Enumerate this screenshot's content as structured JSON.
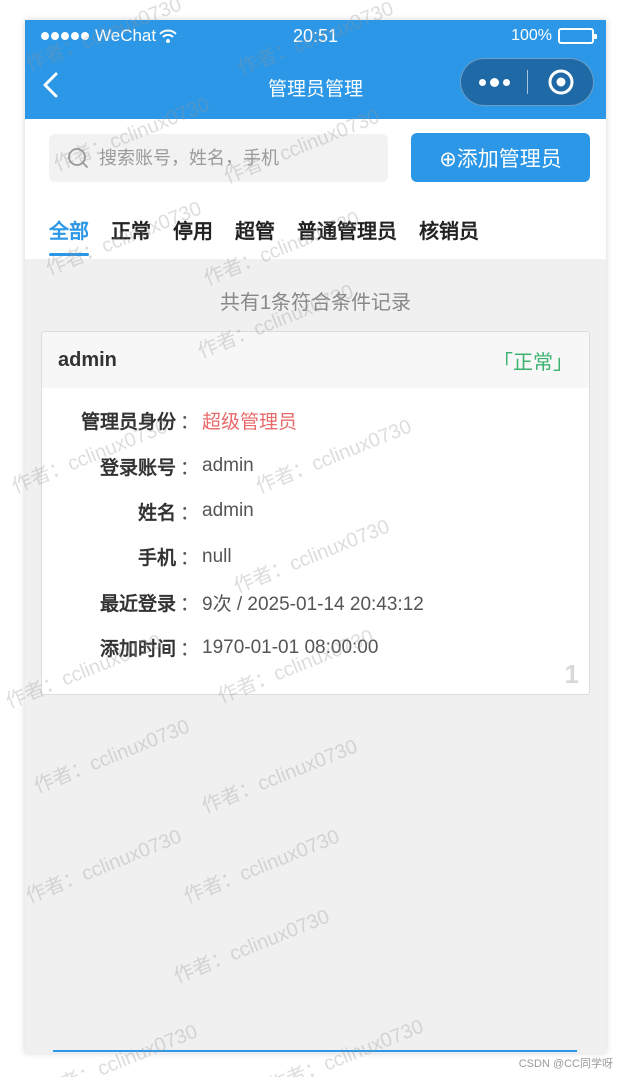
{
  "status_bar": {
    "carrier": "WeChat",
    "time": "20:51",
    "battery": "100%"
  },
  "nav": {
    "title": "管理员管理",
    "back_icon": "chevron-left-icon",
    "more_icon": "more-dots-icon",
    "close_icon": "target-circle-icon"
  },
  "search": {
    "placeholder": "搜索账号，姓名，手机",
    "value": ""
  },
  "add_button": {
    "label": "⊕添加管理员"
  },
  "tabs": [
    {
      "label": "全部",
      "active": true
    },
    {
      "label": "正常"
    },
    {
      "label": "停用"
    },
    {
      "label": "超管"
    },
    {
      "label": "普通管理员"
    },
    {
      "label": "核销员"
    }
  ],
  "result_count": "共有1条符合条件记录",
  "card": {
    "name": "admin",
    "status": "「正常」",
    "index": "1",
    "colon": "：",
    "rows": [
      {
        "label": "管理员身份",
        "value": "超级管理员"
      },
      {
        "label": "登录账号",
        "value": "admin"
      },
      {
        "label": "姓名",
        "value": "admin"
      },
      {
        "label": "手机",
        "value": "null"
      },
      {
        "label": "最近登录",
        "value": "9次 / 2025-01-14 20:43:12"
      },
      {
        "label": "添加时间",
        "value": "1970-01-01 08:00:00"
      }
    ]
  },
  "watermark_text": "作者：cclinux0730",
  "credit": "CSDN @CC同学呀",
  "colors": {
    "primary": "#2b97e6",
    "status_ok": "#3cb371",
    "role_red": "#e86a6a"
  }
}
